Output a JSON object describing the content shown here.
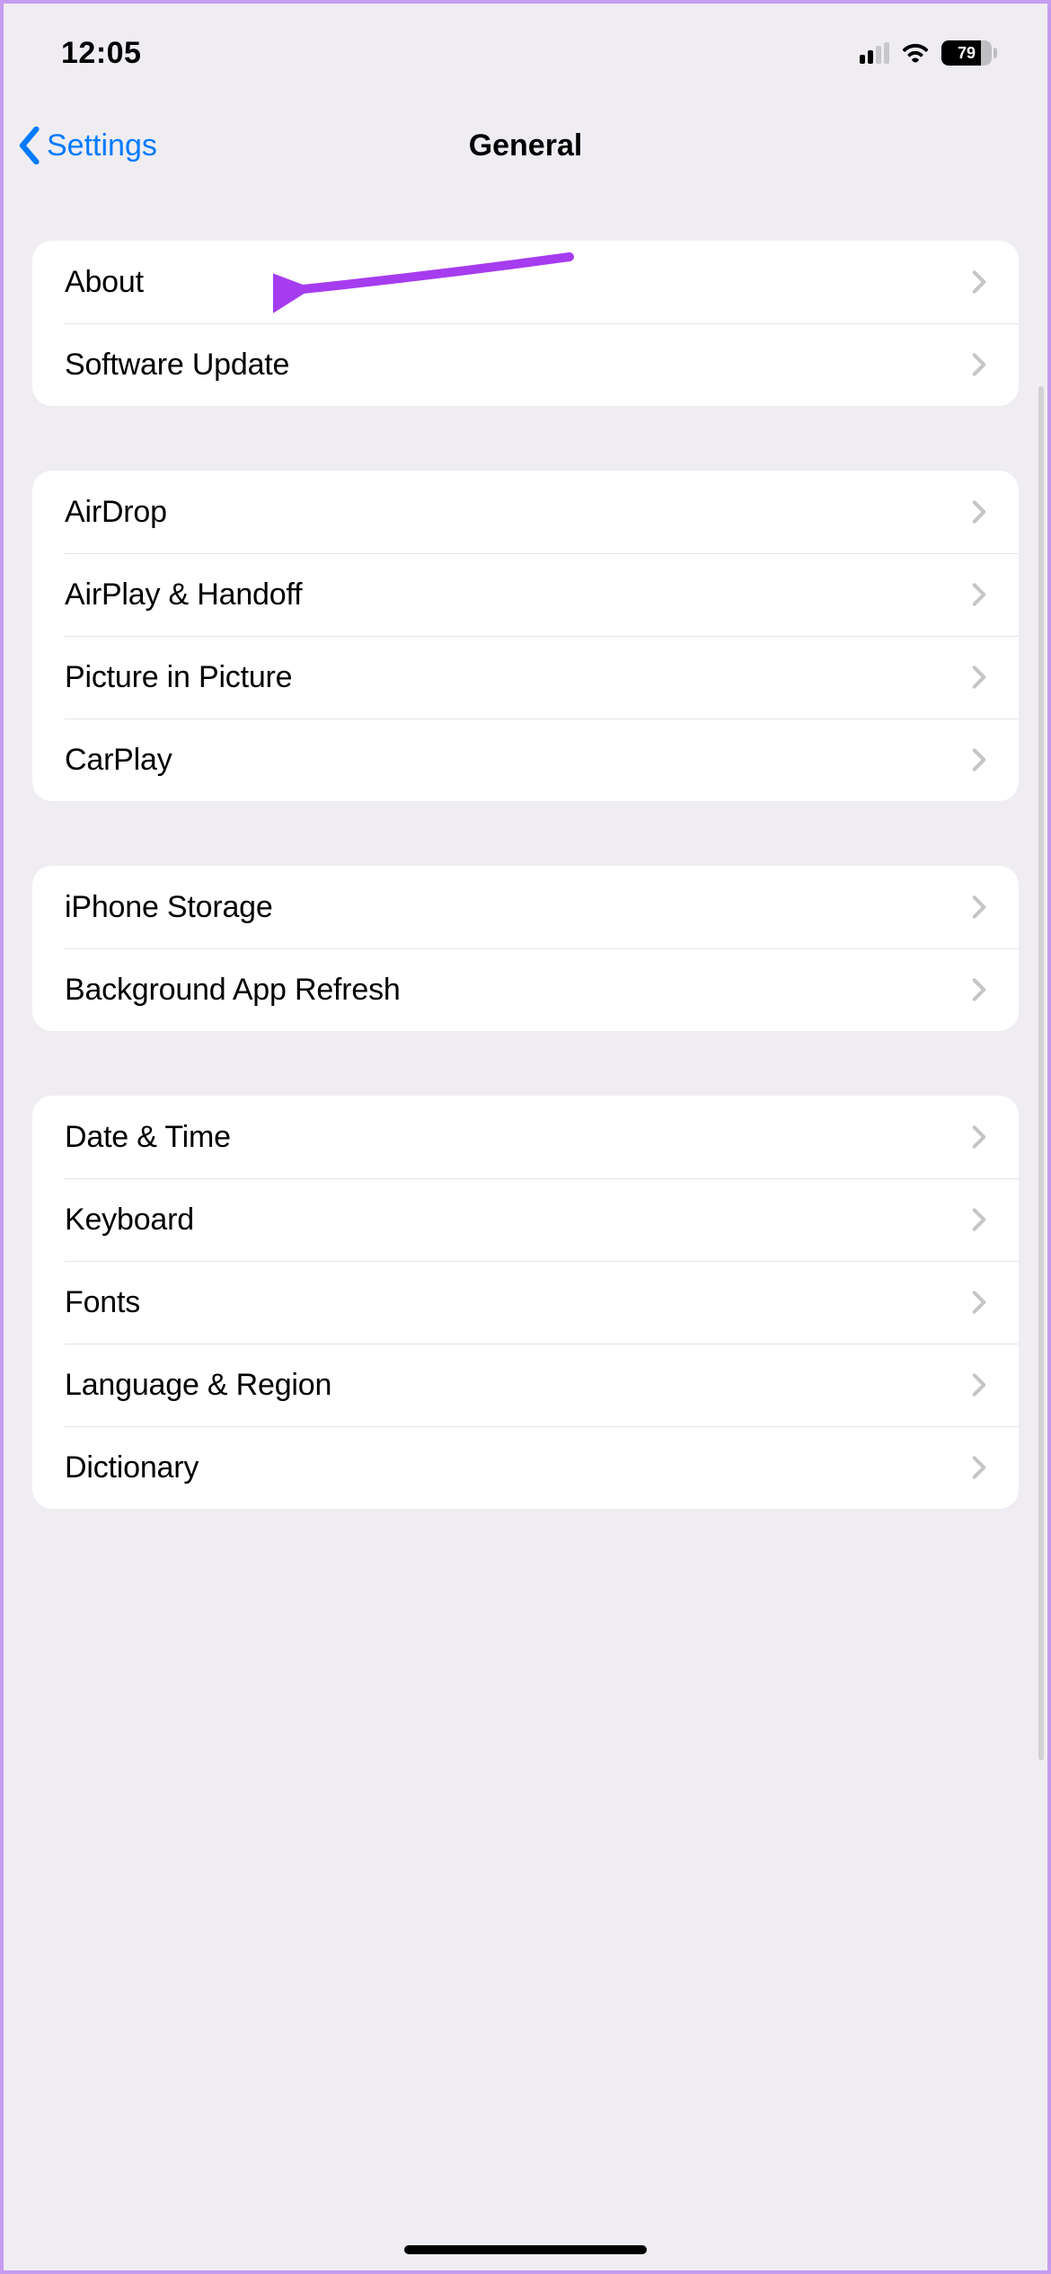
{
  "status": {
    "time": "12:05",
    "battery": "79"
  },
  "nav": {
    "back": "Settings",
    "title": "General"
  },
  "groups": [
    {
      "rows": [
        {
          "key": "about",
          "label": "About"
        },
        {
          "key": "software-update",
          "label": "Software Update"
        }
      ]
    },
    {
      "rows": [
        {
          "key": "airdrop",
          "label": "AirDrop"
        },
        {
          "key": "airplay-handoff",
          "label": "AirPlay & Handoff"
        },
        {
          "key": "picture-in-picture",
          "label": "Picture in Picture"
        },
        {
          "key": "carplay",
          "label": "CarPlay"
        }
      ]
    },
    {
      "rows": [
        {
          "key": "iphone-storage",
          "label": "iPhone Storage"
        },
        {
          "key": "background-app-refresh",
          "label": "Background App Refresh"
        }
      ]
    },
    {
      "rows": [
        {
          "key": "date-time",
          "label": "Date & Time"
        },
        {
          "key": "keyboard",
          "label": "Keyboard"
        },
        {
          "key": "fonts",
          "label": "Fonts"
        },
        {
          "key": "language-region",
          "label": "Language & Region"
        },
        {
          "key": "dictionary",
          "label": "Dictionary"
        }
      ]
    }
  ],
  "annotation": {
    "color": "#a63cf0"
  }
}
